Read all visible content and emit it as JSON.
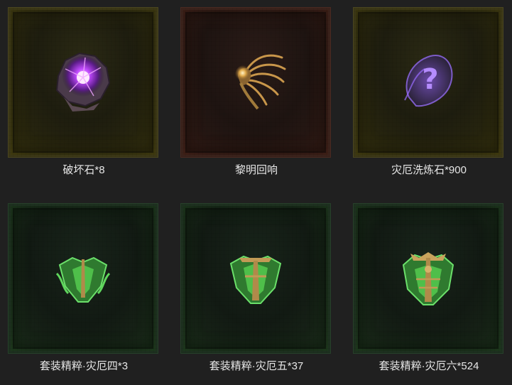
{
  "items": [
    {
      "label": "破坏石*8",
      "icon": "destruction-stone-icon",
      "frame": "gold",
      "glow": "#b13cff"
    },
    {
      "label": "黎明回响",
      "icon": "dawn-echo-phoenix-icon",
      "frame": "red",
      "glow": "#e3b55a"
    },
    {
      "label": "灾厄洗炼石*900",
      "icon": "calamity-reforge-stone-icon",
      "frame": "gold",
      "glow": "#8a4dff"
    },
    {
      "label": "套装精粹·灾厄四*3",
      "icon": "set-essence-calamity-4-icon",
      "frame": "green",
      "glow": "#43d14a"
    },
    {
      "label": "套装精粹·灾厄五*37",
      "icon": "set-essence-calamity-5-icon",
      "frame": "green",
      "glow": "#43d14a"
    },
    {
      "label": "套装精粹·灾厄六*524",
      "icon": "set-essence-calamity-6-icon",
      "frame": "green",
      "glow": "#43d14a"
    }
  ]
}
